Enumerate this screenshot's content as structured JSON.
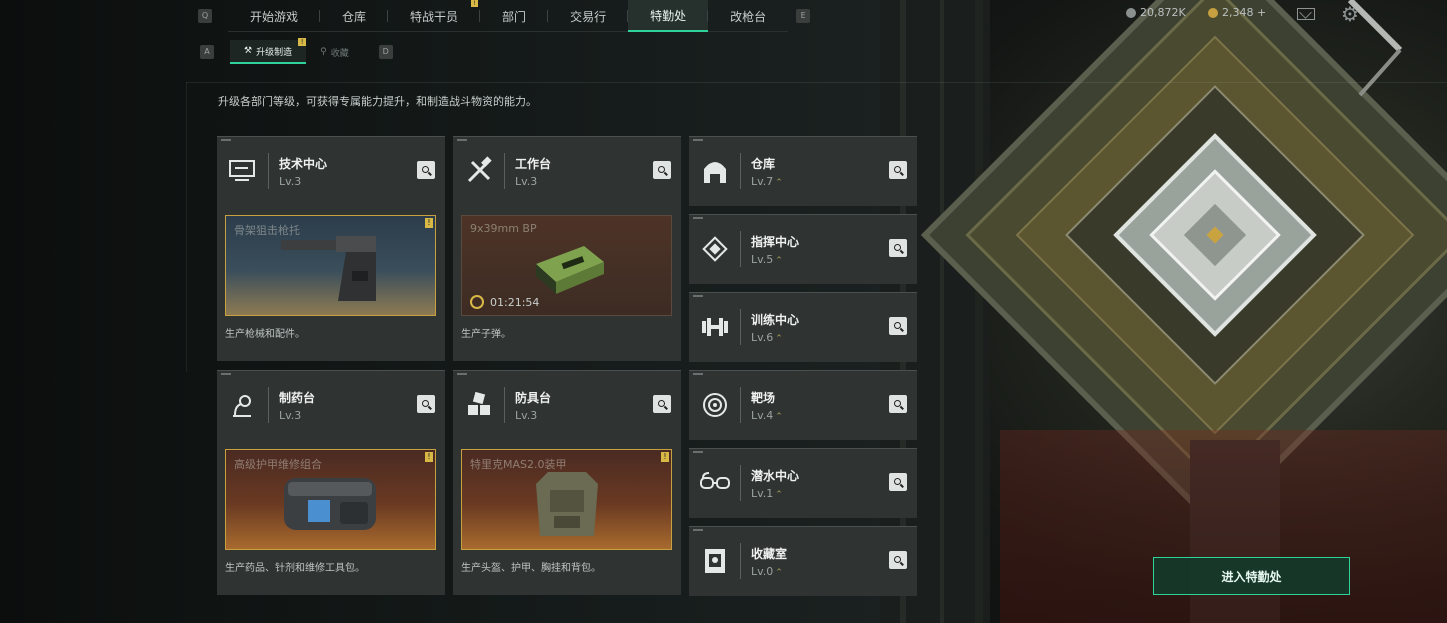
{
  "nav": {
    "left_key": "Q",
    "right_key": "E",
    "tabs": [
      {
        "label": "开始游戏",
        "active": false,
        "notif": false
      },
      {
        "label": "仓库",
        "active": false,
        "notif": false
      },
      {
        "label": "特战干员",
        "active": false,
        "notif": true
      },
      {
        "label": "部门",
        "active": false,
        "notif": false
      },
      {
        "label": "交易行",
        "active": false,
        "notif": false
      },
      {
        "label": "特勤处",
        "active": true,
        "notif": false
      },
      {
        "label": "改枪台",
        "active": false,
        "notif": false
      }
    ]
  },
  "currency": {
    "primary": "20,872K",
    "secondary": "2,348 +"
  },
  "subnav": {
    "left_key": "A",
    "right_key": "D",
    "tabs": [
      {
        "label": "升级制造",
        "active": true
      },
      {
        "label": "收藏",
        "active": false
      }
    ]
  },
  "description": "升级各部门等级，可获得专属能力提升，和制造战斗物资的能力。",
  "facilities": {
    "tech_center": {
      "name": "技术中心",
      "level": "Lv.3",
      "product": "骨架狙击枪托",
      "footer": "生产枪械和配件。"
    },
    "workbench": {
      "name": "工作台",
      "level": "Lv.3",
      "product": "9x39mm BP",
      "timer": "01:21:54",
      "footer": "生产子弹。"
    },
    "pharmacy": {
      "name": "制药台",
      "level": "Lv.3",
      "product": "高级护甲维修组合",
      "footer": "生产药品、针剂和维修工具包。"
    },
    "armory": {
      "name": "防具台",
      "level": "Lv.3",
      "product": "特里克MAS2.0装甲",
      "footer": "生产头盔、护甲、胸挂和背包。"
    },
    "warehouse": {
      "name": "仓库",
      "level": "Lv.7"
    },
    "command_center": {
      "name": "指挥中心",
      "level": "Lv.5"
    },
    "training_center": {
      "name": "训练中心",
      "level": "Lv.6"
    },
    "shooting_range": {
      "name": "靶场",
      "level": "Lv.4"
    },
    "diving_center": {
      "name": "潜水中心",
      "level": "Lv.1"
    },
    "collection_room": {
      "name": "收藏室",
      "level": "Lv.0"
    }
  },
  "upgrade_glyph": "⌃",
  "enter_button": "进入特勤处",
  "colors": {
    "accent": "#2fd39a",
    "highlight_border": "#c79b3a",
    "notif": "#d9b946"
  }
}
